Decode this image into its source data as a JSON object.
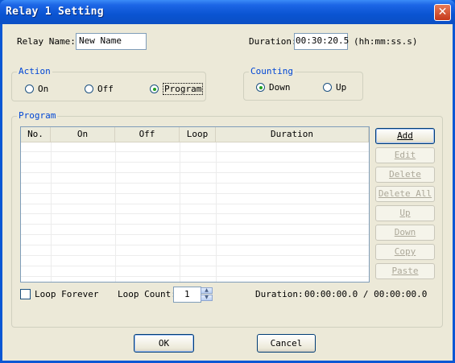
{
  "window": {
    "title": "Relay 1 Setting",
    "close_glyph": "✕"
  },
  "relay_name": {
    "label": "Relay Name:",
    "value": "New Name"
  },
  "duration": {
    "label": "Duration:",
    "value": "00:30:20.5",
    "format_hint": "(hh:mm:ss.s)"
  },
  "action": {
    "legend": "Action",
    "options": [
      {
        "label": "On",
        "selected": false
      },
      {
        "label": "Off",
        "selected": false
      },
      {
        "label": "Program",
        "selected": true
      }
    ]
  },
  "counting": {
    "legend": "Counting",
    "options": [
      {
        "label": "Down",
        "selected": true
      },
      {
        "label": "Up",
        "selected": false
      }
    ]
  },
  "program": {
    "legend": "Program",
    "columns": [
      "No.",
      "On",
      "Off",
      "Loop",
      "Duration"
    ],
    "rows": []
  },
  "side_buttons": [
    {
      "label": "Add",
      "enabled": true
    },
    {
      "label": "Edit",
      "enabled": false
    },
    {
      "label": "Delete",
      "enabled": false
    },
    {
      "label": "Delete All",
      "enabled": false
    },
    {
      "label": "Up",
      "enabled": false
    },
    {
      "label": "Down",
      "enabled": false
    },
    {
      "label": "Copy",
      "enabled": false
    },
    {
      "label": "Paste",
      "enabled": false
    }
  ],
  "loop_forever": {
    "label": "Loop Forever",
    "checked": false
  },
  "loop_count": {
    "label": "Loop Count:",
    "value": "1"
  },
  "total_duration": {
    "label": "Duration:",
    "value": "00:00:00.0 / 00:00:00.0"
  },
  "footer": {
    "ok_label": "OK",
    "cancel_label": "Cancel"
  },
  "colors": {
    "title_bar": "#0a54d2",
    "dialog_bg": "#ece9d8",
    "group_legend": "#0046d5",
    "disabled_text": "#aca899"
  }
}
